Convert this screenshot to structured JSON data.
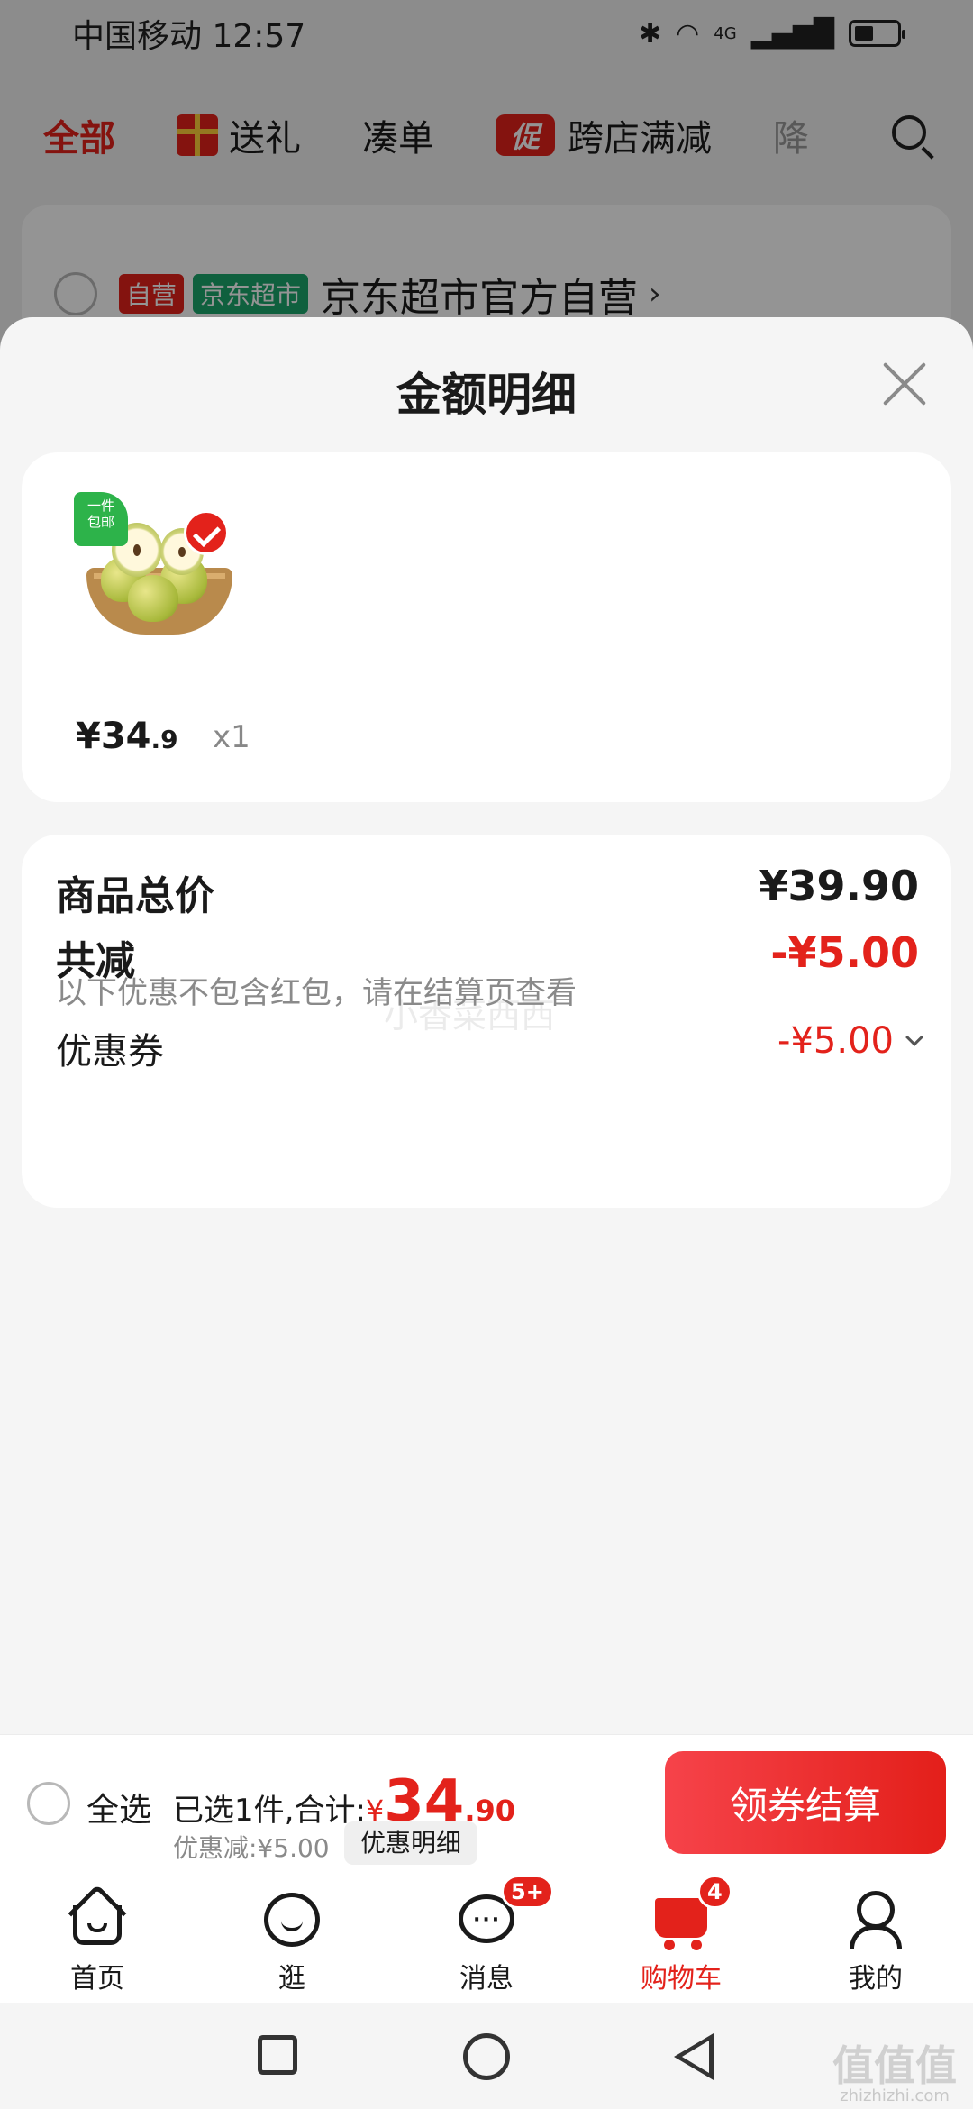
{
  "status_bar": {
    "carrier": "中国移动",
    "time": "12:57",
    "network": "4G"
  },
  "filter_bar": {
    "items": [
      {
        "label": "全部",
        "active": true
      },
      {
        "label": "送礼",
        "icon": "gift-icon"
      },
      {
        "label": "凑单"
      },
      {
        "label": "跨店满减",
        "badge": "促"
      },
      {
        "label": "降"
      }
    ]
  },
  "shop": {
    "tag_self": "自营",
    "tag_market": "京东超市",
    "name": "京东超市官方自营",
    "chevron": "›"
  },
  "sheet": {
    "title": "金额明细",
    "goods": {
      "free_tag_line1": "一件",
      "free_tag_line2": "包邮",
      "price_int": "¥34",
      "price_dec": ".9",
      "qty": "x1"
    },
    "summary": {
      "total_label": "商品总价",
      "total_value": "¥39.90",
      "reduce_label": "共减",
      "reduce_value": "-¥5.00",
      "reduce_note": "以下优惠不包含红包，请在结算页查看",
      "coupon_label": "优惠券",
      "coupon_value": "-¥5.00",
      "watermark": "小香菜西西"
    }
  },
  "checkout": {
    "select_all": "全选",
    "selected_text": "已选1件,合计:",
    "yen": "¥",
    "amount_big": "34",
    "amount_small": ".90",
    "discount_text": "优惠减:¥5.00",
    "detail_button": "优惠明细",
    "checkout_button": "领券结算"
  },
  "tab_bar": {
    "tabs": [
      {
        "label": "首页",
        "icon": "home-icon"
      },
      {
        "label": "逛",
        "icon": "face-icon"
      },
      {
        "label": "消息",
        "icon": "message-icon",
        "badge": "5+"
      },
      {
        "label": "购物车",
        "icon": "cart-icon",
        "badge": "4",
        "active": true
      },
      {
        "label": "我的",
        "icon": "profile-icon"
      }
    ]
  },
  "watermark_corner": {
    "logo": "值值值",
    "site": "zhizhizhi.com"
  },
  "colors": {
    "accent": "#e3221b",
    "green": "#1aa56b",
    "background": "#f5f5f5"
  }
}
